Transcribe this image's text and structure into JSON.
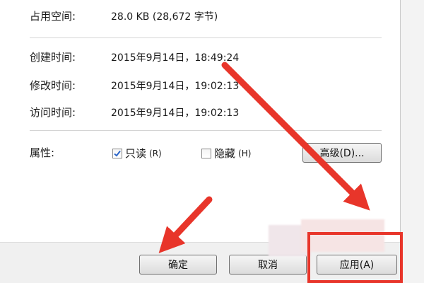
{
  "properties": {
    "size_on_disk": {
      "label": "占用空间:",
      "value": "28.0 KB (28,672 字节)"
    },
    "created": {
      "label": "创建时间:",
      "value": "2015年9月14日，18:49:24"
    },
    "modified": {
      "label": "修改时间:",
      "value": "2015年9月14日，19:02:13"
    },
    "accessed": {
      "label": "访问时间:",
      "value": "2015年9月14日，19:02:13"
    }
  },
  "attributes": {
    "label": "属性:",
    "readonly": {
      "label": "只读",
      "shortcut": "(R)",
      "checked": true
    },
    "hidden": {
      "label": "隐藏",
      "shortcut": "(H)",
      "checked": false
    },
    "advanced_button": "高级(D)..."
  },
  "footer": {
    "ok": "确定",
    "cancel": "取消",
    "apply": "应用(A)"
  },
  "colors": {
    "annotation_red": "#e8352a",
    "check_blue": "#2a64c8"
  }
}
